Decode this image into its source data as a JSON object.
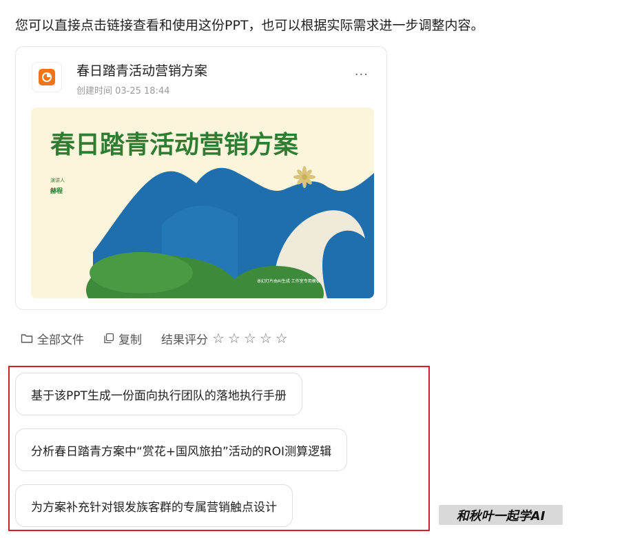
{
  "intro_text": "您可以直接点击链接查看和使用这份PPT，也可以根据实际需求进一步调整内容。",
  "file_card": {
    "title": "春日踏青活动营销方案",
    "meta": "创建时间 03-25 18:44",
    "more_label": "···",
    "icon": "ppt-file-icon",
    "accent_color": "#f07418",
    "thumbnail": {
      "headline": "春日踏青活动营销方案",
      "presenter_label": "演讲人",
      "presenter_name": "赫程",
      "footer_text": "本幻灯片由AI生成 工作室专用模板"
    }
  },
  "actions": {
    "all_files": "全部文件",
    "copy": "复制",
    "rating_label": "结果评分",
    "stars": [
      "☆",
      "☆",
      "☆",
      "☆",
      "☆"
    ]
  },
  "suggestions": [
    "基于该PPT生成一份面向执行团队的落地执行手册",
    "分析春日踏青方案中“赏花+国风旅拍”活动的ROI测算逻辑",
    "为方案补充针对银发族客群的专属营销触点设计"
  ],
  "watermark": "和秋叶一起学AI",
  "colors": {
    "highlight_border": "#d21f26",
    "thumb_bg": "#fbf5dc",
    "mountain_blue": "#1f6fae",
    "hill_green": "#3c8a3a",
    "title_green": "#2f7d32"
  }
}
